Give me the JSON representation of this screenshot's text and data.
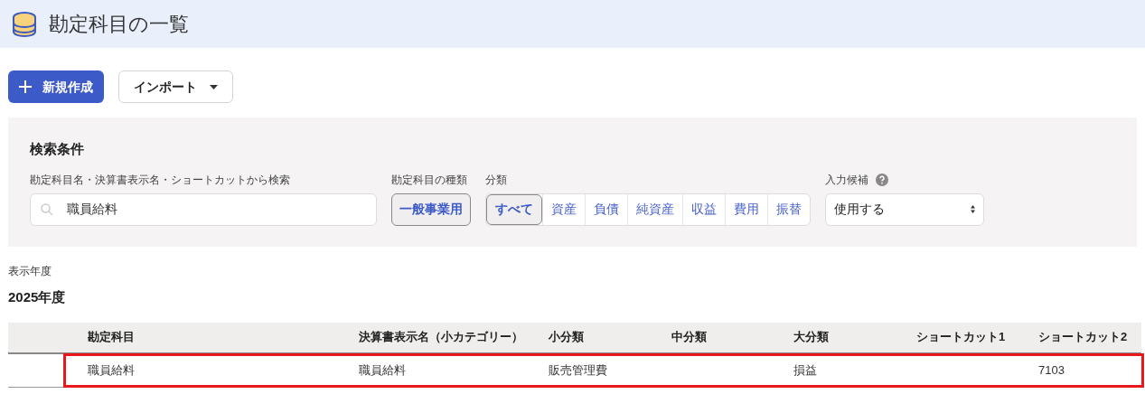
{
  "page_title": "勘定科目の一覧",
  "toolbar": {
    "new_button": "新規作成",
    "import_button": "インポート"
  },
  "search": {
    "title": "検索条件",
    "keyword": {
      "label": "勘定科目名・決算書表示名・ショートカットから検索",
      "value": "職員給料"
    },
    "account_type": {
      "label": "勘定科目の種類",
      "button": "一般事業用"
    },
    "category": {
      "label": "分類",
      "options": [
        {
          "label": "すべて",
          "selected": true
        },
        {
          "label": "資産",
          "selected": false
        },
        {
          "label": "負債",
          "selected": false
        },
        {
          "label": "純資産",
          "selected": false
        },
        {
          "label": "収益",
          "selected": false
        },
        {
          "label": "費用",
          "selected": false
        },
        {
          "label": "振替",
          "selected": false
        }
      ]
    },
    "suggest": {
      "label": "入力候補",
      "value": "使用する"
    }
  },
  "year": {
    "label": "表示年度",
    "value": "2025年度"
  },
  "table": {
    "columns": [
      "勘定科目",
      "決算書表示名（小カテゴリー）",
      "小分類",
      "中分類",
      "大分類",
      "ショートカット1",
      "ショートカット2"
    ],
    "rows": [
      {
        "highlighted": true,
        "cells": [
          "職員給料",
          "職員給料",
          "販売管理費",
          null,
          "損益",
          null,
          "7103"
        ]
      }
    ]
  }
}
